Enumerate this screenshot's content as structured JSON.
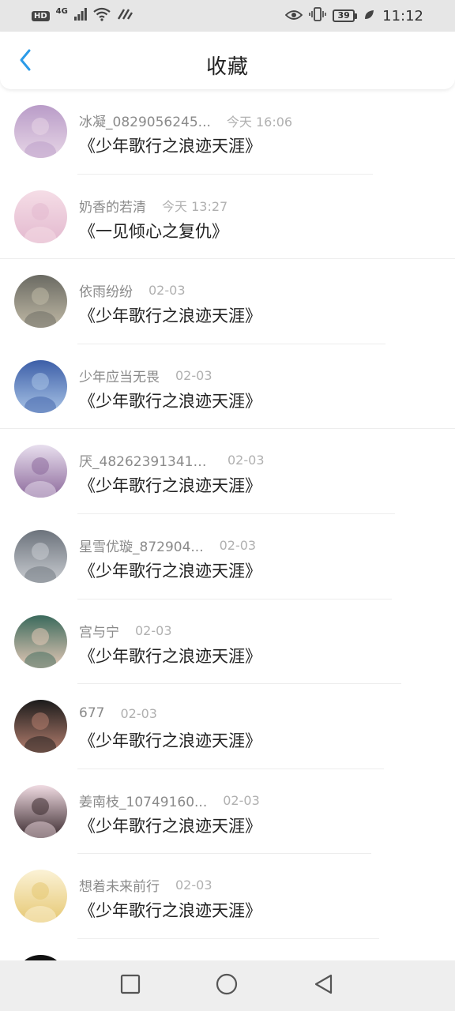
{
  "status_bar": {
    "hd": "HD",
    "network": "4G",
    "battery": "39",
    "time": "11:12"
  },
  "header": {
    "title": "收藏",
    "back_icon": "chevron-left-icon",
    "accent_color": "#2b9be8"
  },
  "favorites": [
    {
      "user": "冰凝_0829056245...",
      "time": "今天 16:06",
      "title": "《少年歌行之浪迹天涯》",
      "avatar_colors": [
        "#b99cc8",
        "#e7d6e6"
      ]
    },
    {
      "user": "奶香的若清",
      "time": "今天 13:27",
      "title": "《一见倾心之复仇》",
      "avatar_colors": [
        "#f5dde6",
        "#e3b9cf"
      ]
    },
    {
      "user": "依雨纷纷",
      "time": "02-03",
      "title": "《少年歌行之浪迹天涯》",
      "avatar_colors": [
        "#6a6a62",
        "#c0b9a6"
      ]
    },
    {
      "user": "少年应当无畏",
      "time": "02-03",
      "title": "《少年歌行之浪迹天涯》",
      "avatar_colors": [
        "#3d5fa8",
        "#a8c3e6"
      ]
    },
    {
      "user": "厌_482623913412...",
      "time": "02-03",
      "title": "《少年歌行之浪迹天涯》",
      "avatar_colors": [
        "#e8dfee",
        "#8d6a9c"
      ]
    },
    {
      "user": "星雪优璇_872904...",
      "time": "02-03",
      "title": "《少年歌行之浪迹天涯》",
      "avatar_colors": [
        "#6c737c",
        "#c9ccd1"
      ]
    },
    {
      "user": "宫与宁",
      "time": "02-03",
      "title": "《少年歌行之浪迹天涯》",
      "avatar_colors": [
        "#3b6a5c",
        "#e4c8b6"
      ]
    },
    {
      "user": "677",
      "time": "02-03",
      "title": "《少年歌行之浪迹天涯》",
      "avatar_colors": [
        "#1b1b1b",
        "#b47e6e"
      ]
    },
    {
      "user": "姜南枝_10749160...",
      "time": "02-03",
      "title": "《少年歌行之浪迹天涯》",
      "avatar_colors": [
        "#f0dbe2",
        "#3a2a2e"
      ]
    },
    {
      "user": "想着未来前行",
      "time": "02-03",
      "title": "《少年歌行之浪迹天涯》",
      "avatar_colors": [
        "#fbf2d6",
        "#e6c873"
      ]
    }
  ],
  "nav_bar": {
    "recent_icon": "square-icon",
    "home_icon": "circle-icon",
    "back_icon": "triangle-back-icon"
  }
}
